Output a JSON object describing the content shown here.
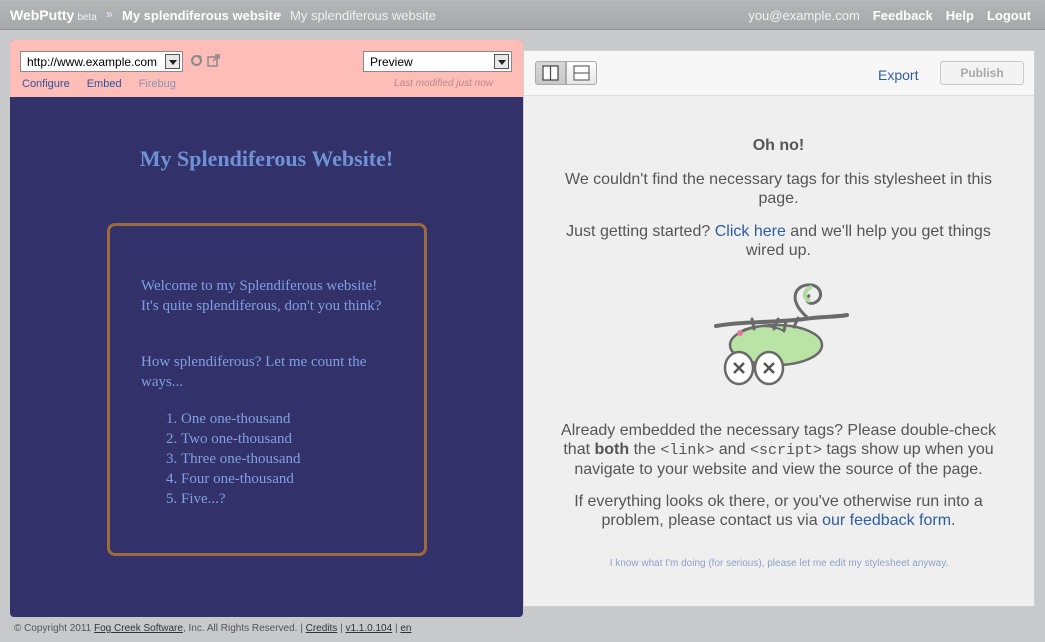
{
  "header": {
    "brand": "WebPutty",
    "beta": "beta",
    "separator": "»",
    "crumb_site": "My splendiferous website",
    "crumb_sheet": "My splendiferous website",
    "email": "you@example.com",
    "links": [
      "Feedback",
      "Help",
      "Logout"
    ]
  },
  "editor": {
    "url_value": "http://www.example.com",
    "mode_value": "Preview",
    "refresh_icon": "refresh-icon",
    "external_icon": "external-link-icon",
    "tabs": [
      "Configure",
      "Embed",
      "Firebug"
    ],
    "last_modified": "Last modified just now"
  },
  "preview_site": {
    "title": "My Splendiferous Website!",
    "para1": "Welcome to my Splendiferous website! It's quite splendiferous, don't you think?",
    "para2": "How splendiferous? Let me count the ways...",
    "list": [
      "One one-thousand",
      "Two one-thousand",
      "Three one-thousand",
      "Four one-thousand",
      "Five...?"
    ]
  },
  "right_panel": {
    "view_buttons": [
      "split-vertical-icon",
      "split-horizontal-icon"
    ],
    "export_label": "Export",
    "publish_label": "Publish",
    "oh_no": "Oh no!",
    "msg1": "We couldn't find the necessary tags for this stylesheet in this page.",
    "msg2_pre": "Just getting started?",
    "msg2_link": "Click here",
    "msg2_post": "and we'll help you get things wired up.",
    "msg3_pre": "Already embedded the necessary tags? Please double-check that",
    "msg3_bold": "both",
    "msg3_the": "the",
    "msg3_link_tag": "<link>",
    "msg3_and": "and",
    "msg3_script_tag": "<script>",
    "msg3_post": "tags show up when you navigate to your website and view the source of the page.",
    "msg4_pre": "If everything looks ok there, or you've otherwise run into a problem, please contact us via",
    "msg4_link": "our feedback form",
    "msg4_post": ".",
    "anyway": "I know what I'm doing (for serious), please let me edit my stylesheet anyway."
  },
  "footer": {
    "copyright": "© Copyright 2011",
    "company": "Fog Creek Software",
    "rights": ", Inc. All Rights Reserved. |",
    "credits": "Credits",
    "bar1": "|",
    "version": "v1.1.0.104",
    "bar2": "|",
    "lang": "en"
  }
}
